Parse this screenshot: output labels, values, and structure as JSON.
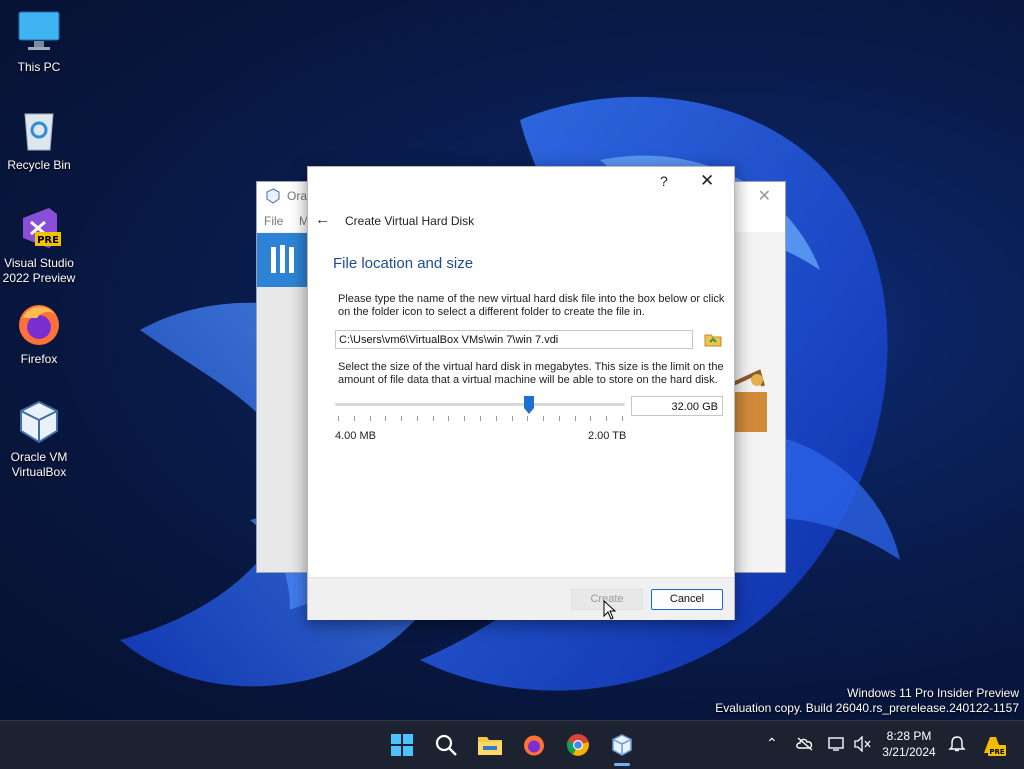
{
  "desktop": {
    "icons": [
      {
        "label": "This PC"
      },
      {
        "label": "Recycle Bin"
      },
      {
        "label": "Visual Studio 2022 Preview",
        "badge": "PRE"
      },
      {
        "label": "Firefox"
      },
      {
        "label": "Oracle VM VirtualBox"
      }
    ]
  },
  "bg_window": {
    "title": "Ora",
    "menu": [
      "File",
      "M"
    ]
  },
  "dialog": {
    "help": "?",
    "close": "✕",
    "back": "←",
    "title": "Create Virtual Hard Disk",
    "heading": "File location and size",
    "instruction1": "Please type the name of the new virtual hard disk file into the box below or click on the folder icon to select a different folder to create the file in.",
    "file_path": "C:\\Users\\vm6\\VirtualBox VMs\\win 7\\win 7.vdi",
    "instruction2": "Select the size of the virtual hard disk in megabytes. This size is the limit on the amount of file data that a virtual machine will be able to store on the hard disk.",
    "slider_position": 0.67,
    "size_value": "32.00 GB",
    "min_label": "4.00 MB",
    "max_label": "2.00 TB",
    "create_label": "Create",
    "cancel_label": "Cancel"
  },
  "watermark": {
    "line1": "Windows 11 Pro Insider Preview",
    "line2": "Evaluation copy. Build 26040.rs_prerelease.240122-1157"
  },
  "taskbar": {
    "apps": [
      "start-icon",
      "search-icon",
      "file-explorer-icon",
      "firefox-icon",
      "chrome-icon",
      "virtualbox-icon"
    ],
    "time": "8:28 PM",
    "date": "3/21/2024",
    "pre_badge": "PRE"
  },
  "colors": {
    "accent": "#1c4d92",
    "button_focus": "#2067c8",
    "taskbar": "#1c2230"
  }
}
